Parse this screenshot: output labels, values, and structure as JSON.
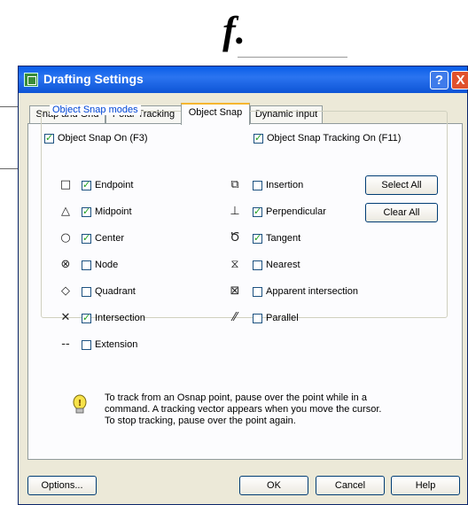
{
  "caption": "f.",
  "window": {
    "title": "Drafting Settings",
    "help_glyph": "?",
    "close_glyph": "X",
    "accent": "#0a5ee8"
  },
  "tabs": [
    "Snap and Grid",
    "Polar Tracking",
    "Object Snap",
    "Dynamic Input"
  ],
  "active_tab": "Object Snap",
  "object_snap_on": {
    "label": "Object Snap On (F3)",
    "checked": true
  },
  "object_snap_tracking_on": {
    "label": "Object Snap Tracking On (F11)",
    "checked": true
  },
  "modes_group_title": "Object Snap modes",
  "modes_left": [
    {
      "icon": "endpoint-icon",
      "glyph": "□",
      "label": "Endpoint",
      "checked": true
    },
    {
      "icon": "midpoint-icon",
      "glyph": "△",
      "label": "Midpoint",
      "checked": true
    },
    {
      "icon": "center-icon",
      "glyph": "○",
      "label": "Center",
      "checked": true
    },
    {
      "icon": "node-icon",
      "glyph": "⊗",
      "label": "Node",
      "checked": false
    },
    {
      "icon": "quadrant-icon",
      "glyph": "◇",
      "label": "Quadrant",
      "checked": false
    },
    {
      "icon": "intersection-icon",
      "glyph": "✕",
      "label": "Intersection",
      "checked": true
    },
    {
      "icon": "extension-icon",
      "glyph": "--",
      "label": "Extension",
      "checked": false
    }
  ],
  "modes_right": [
    {
      "icon": "insertion-icon",
      "glyph": "⧉",
      "label": "Insertion",
      "checked": false
    },
    {
      "icon": "perpendicular-icon",
      "glyph": "⊥",
      "label": "Perpendicular",
      "checked": true
    },
    {
      "icon": "tangent-icon",
      "glyph": "Ծ",
      "label": "Tangent",
      "checked": true
    },
    {
      "icon": "nearest-icon",
      "glyph": "⧖",
      "label": "Nearest",
      "checked": false
    },
    {
      "icon": "apparent-intersection-icon",
      "glyph": "⊠",
      "label": "Apparent intersection",
      "checked": false
    },
    {
      "icon": "parallel-icon",
      "glyph": "⁄⁄",
      "label": "Parallel",
      "checked": false
    }
  ],
  "select_all": "Select All",
  "clear_all": "Clear All",
  "tip": "To track from an Osnap point, pause over the point while in a\ncommand.  A tracking vector appears when you move the cursor.\nTo stop tracking, pause over the point again.",
  "buttons": {
    "options": "Options...",
    "ok": "OK",
    "cancel": "Cancel",
    "help": "Help"
  }
}
